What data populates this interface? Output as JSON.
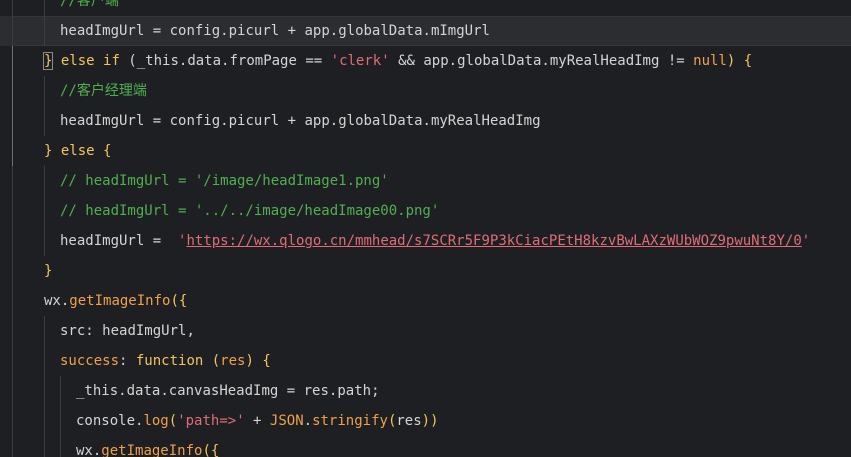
{
  "editor": {
    "lines": [
      {
        "current": false,
        "indent": 2,
        "tokens": [
          {
            "t": "//客户端",
            "c": "com"
          }
        ]
      },
      {
        "current": true,
        "indent": 2,
        "tokens": [
          {
            "t": "headImgUrl",
            "c": "var"
          },
          {
            "t": " = ",
            "c": "op"
          },
          {
            "t": "config",
            "c": "var"
          },
          {
            "t": ".",
            "c": "op"
          },
          {
            "t": "picurl",
            "c": "prop"
          },
          {
            "t": " + ",
            "c": "op"
          },
          {
            "t": "app",
            "c": "var"
          },
          {
            "t": ".",
            "c": "op"
          },
          {
            "t": "globalData",
            "c": "prop"
          },
          {
            "t": ".",
            "c": "op"
          },
          {
            "t": "mImgUrl",
            "c": "prop"
          }
        ]
      },
      {
        "current": false,
        "indent": 1,
        "tokens": [
          {
            "t": "}",
            "c": "kw",
            "box": true
          },
          {
            "t": " else if",
            "c": "kw"
          },
          {
            "t": " (",
            "c": "op"
          },
          {
            "t": "_this",
            "c": "var"
          },
          {
            "t": ".",
            "c": "op"
          },
          {
            "t": "data",
            "c": "prop"
          },
          {
            "t": ".",
            "c": "op"
          },
          {
            "t": "fromPage",
            "c": "prop"
          },
          {
            "t": " == ",
            "c": "op"
          },
          {
            "t": "'clerk'",
            "c": "str"
          },
          {
            "t": " && ",
            "c": "op"
          },
          {
            "t": "app",
            "c": "var"
          },
          {
            "t": ".",
            "c": "op"
          },
          {
            "t": "globalData",
            "c": "prop"
          },
          {
            "t": ".",
            "c": "op"
          },
          {
            "t": "myRealHeadImg",
            "c": "prop"
          },
          {
            "t": " != ",
            "c": "op"
          },
          {
            "t": "null",
            "c": "null"
          },
          {
            "t": ") {",
            "c": "kw"
          }
        ]
      },
      {
        "current": false,
        "indent": 2,
        "tokens": [
          {
            "t": "//客户经理端",
            "c": "com"
          }
        ]
      },
      {
        "current": false,
        "indent": 2,
        "tokens": [
          {
            "t": "headImgUrl",
            "c": "var"
          },
          {
            "t": " = ",
            "c": "op"
          },
          {
            "t": "config",
            "c": "var"
          },
          {
            "t": ".",
            "c": "op"
          },
          {
            "t": "picurl",
            "c": "prop"
          },
          {
            "t": " + ",
            "c": "op"
          },
          {
            "t": "app",
            "c": "var"
          },
          {
            "t": ".",
            "c": "op"
          },
          {
            "t": "globalData",
            "c": "prop"
          },
          {
            "t": ".",
            "c": "op"
          },
          {
            "t": "myRealHeadImg",
            "c": "prop"
          }
        ]
      },
      {
        "current": false,
        "indent": 1,
        "tokens": [
          {
            "t": "} else {",
            "c": "kw"
          }
        ]
      },
      {
        "current": false,
        "indent": 2,
        "tokens": [
          {
            "t": "// headImgUrl = '/image/headImage1.png'",
            "c": "com"
          }
        ]
      },
      {
        "current": false,
        "indent": 2,
        "tokens": [
          {
            "t": "// headImgUrl = '../../image/headImage00.png'",
            "c": "com"
          }
        ]
      },
      {
        "current": false,
        "indent": 2,
        "tokens": [
          {
            "t": "headImgUrl",
            "c": "var"
          },
          {
            "t": " =  ",
            "c": "op"
          },
          {
            "t": "'",
            "c": "str"
          },
          {
            "t": "https://wx.qlogo.cn/mmhead/s7SCRr5F9P3kCiacPEtH8kzvBwLAXzWUbWOZ9pwuNt8Y/0",
            "c": "url"
          },
          {
            "t": "'",
            "c": "str"
          }
        ]
      },
      {
        "current": false,
        "indent": 1,
        "tokens": [
          {
            "t": "}",
            "c": "kw"
          }
        ]
      },
      {
        "current": false,
        "indent": 1,
        "tokens": [
          {
            "t": "wx",
            "c": "var"
          },
          {
            "t": ".",
            "c": "op"
          },
          {
            "t": "getImageInfo",
            "c": "fn"
          },
          {
            "t": "({",
            "c": "kw"
          }
        ]
      },
      {
        "current": false,
        "indent": 2,
        "tokens": [
          {
            "t": "src",
            "c": "prop"
          },
          {
            "t": ": ",
            "c": "op"
          },
          {
            "t": "headImgUrl",
            "c": "var"
          },
          {
            "t": ",",
            "c": "op"
          }
        ]
      },
      {
        "current": false,
        "indent": 2,
        "tokens": [
          {
            "t": "success",
            "c": "fn"
          },
          {
            "t": ": ",
            "c": "op"
          },
          {
            "t": "function",
            "c": "kw"
          },
          {
            "t": " (",
            "c": "kw"
          },
          {
            "t": "res",
            "c": "fn"
          },
          {
            "t": ") {",
            "c": "kw"
          }
        ]
      },
      {
        "current": false,
        "indent": 3,
        "tokens": [
          {
            "t": "_this",
            "c": "var"
          },
          {
            "t": ".",
            "c": "op"
          },
          {
            "t": "data",
            "c": "prop"
          },
          {
            "t": ".",
            "c": "op"
          },
          {
            "t": "canvasHeadImg",
            "c": "prop"
          },
          {
            "t": " = ",
            "c": "op"
          },
          {
            "t": "res",
            "c": "var"
          },
          {
            "t": ".",
            "c": "op"
          },
          {
            "t": "path",
            "c": "prop"
          },
          {
            "t": ";",
            "c": "op"
          }
        ]
      },
      {
        "current": false,
        "indent": 3,
        "tokens": [
          {
            "t": "console",
            "c": "var"
          },
          {
            "t": ".",
            "c": "op"
          },
          {
            "t": "log",
            "c": "fn"
          },
          {
            "t": "(",
            "c": "kw"
          },
          {
            "t": "'path=>'",
            "c": "str"
          },
          {
            "t": " + ",
            "c": "op"
          },
          {
            "t": "JSON",
            "c": "glob"
          },
          {
            "t": ".",
            "c": "op"
          },
          {
            "t": "stringify",
            "c": "fn"
          },
          {
            "t": "(",
            "c": "kw"
          },
          {
            "t": "res",
            "c": "var"
          },
          {
            "t": "))",
            "c": "kw"
          }
        ]
      },
      {
        "current": false,
        "indent": 3,
        "tokens": [
          {
            "t": "wx",
            "c": "var"
          },
          {
            "t": ".",
            "c": "op"
          },
          {
            "t": "getImageInfo",
            "c": "fn"
          },
          {
            "t": "({",
            "c": "kw"
          }
        ]
      }
    ]
  }
}
